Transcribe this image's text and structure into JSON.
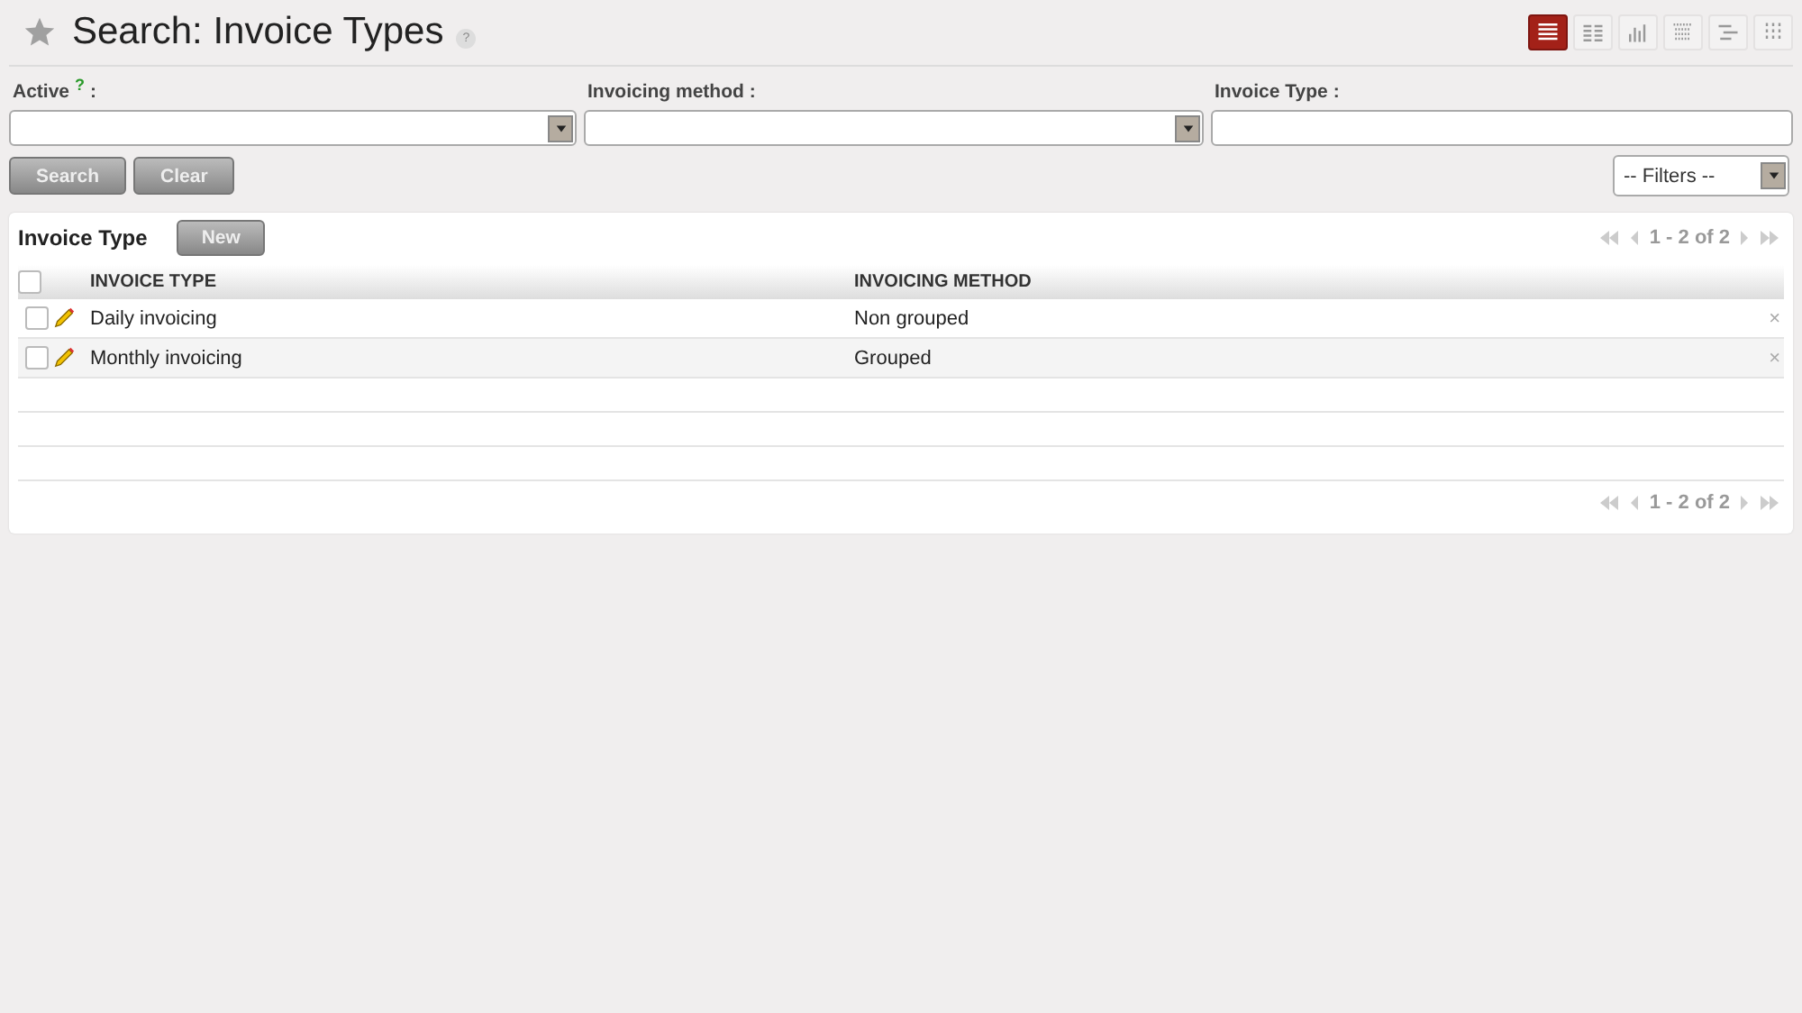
{
  "page": {
    "title": "Search: Invoice Types",
    "help": "?"
  },
  "view_modes": [
    {
      "kind": "list",
      "selected": true
    },
    {
      "kind": "table",
      "selected": false
    },
    {
      "kind": "graph",
      "selected": false
    },
    {
      "kind": "calendar",
      "selected": false
    },
    {
      "kind": "gantt",
      "selected": false
    },
    {
      "kind": "grid",
      "selected": false
    }
  ],
  "search_fields": [
    {
      "label": "Active",
      "help": "?",
      "colon": ":",
      "kind": "select"
    },
    {
      "label": "Invoicing method",
      "colon": ":",
      "kind": "select"
    },
    {
      "label": "Invoice Type",
      "colon": ":",
      "kind": "text"
    }
  ],
  "buttons": [
    "Search",
    "Clear"
  ],
  "filters": {
    "value": "-- Filters --"
  },
  "list": {
    "title": "Invoice Type",
    "new_button": "New",
    "pager": "1 - 2 of 2",
    "footer_pager": "1 - 2 of 2",
    "columns": [
      "INVOICE TYPE",
      "INVOICING METHOD"
    ],
    "rows": [
      {
        "cells": [
          "Daily invoicing",
          "Non grouped"
        ],
        "checked": false,
        "delete": "×"
      },
      {
        "cells": [
          "Monthly invoicing",
          "Grouped"
        ],
        "checked": false,
        "delete": "×"
      }
    ],
    "select_all": {
      "checked": false
    }
  }
}
